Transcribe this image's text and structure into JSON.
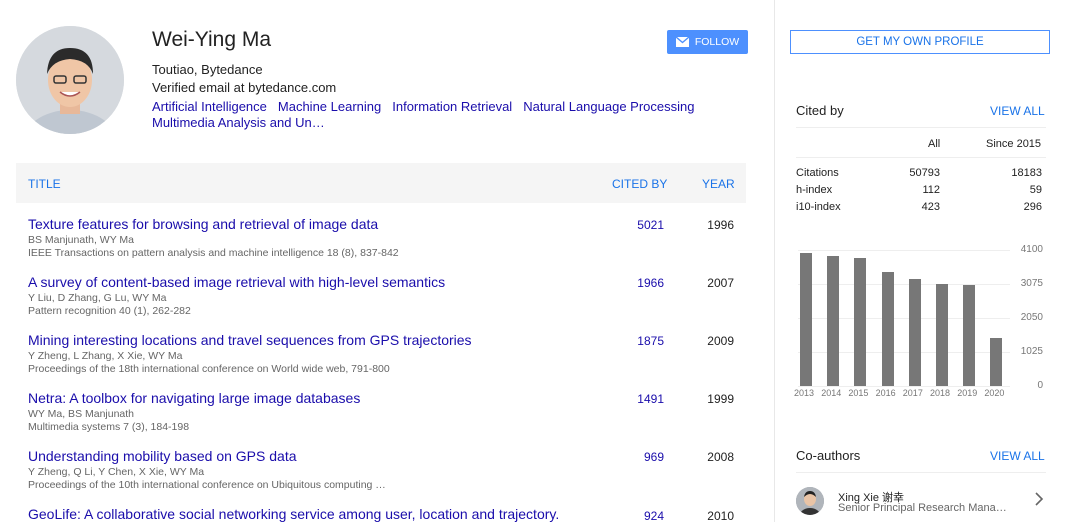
{
  "profile": {
    "name": "Wei-Ying Ma",
    "affiliation": "Toutiao, Bytedance",
    "email": "Verified email at bytedance.com",
    "interests": [
      "Artificial Intelligence",
      "Machine Learning",
      "Information Retrieval",
      "Natural Language Processing",
      "Multimedia Analysis and Un…"
    ],
    "follow_label": "FOLLOW"
  },
  "table": {
    "col_title": "TITLE",
    "col_cited": "CITED BY",
    "col_year": "YEAR",
    "rows": [
      {
        "title": "Texture features for browsing and retrieval of image data",
        "authors": "BS Manjunath, WY Ma",
        "venue": "IEEE Transactions on pattern analysis and machine intelligence 18 (8), 837-842",
        "cited": "5021",
        "year": "1996"
      },
      {
        "title": "A survey of content-based image retrieval with high-level semantics",
        "authors": "Y Liu, D Zhang, G Lu, WY Ma",
        "venue": "Pattern recognition 40 (1), 262-282",
        "cited": "1966",
        "year": "2007"
      },
      {
        "title": "Mining interesting locations and travel sequences from GPS trajectories",
        "authors": "Y Zheng, L Zhang, X Xie, WY Ma",
        "venue": "Proceedings of the 18th international conference on World wide web, 791-800",
        "cited": "1875",
        "year": "2009"
      },
      {
        "title": "Netra: A toolbox for navigating large image databases",
        "authors": "WY Ma, BS Manjunath",
        "venue": "Multimedia systems 7 (3), 184-198",
        "cited": "1491",
        "year": "1999"
      },
      {
        "title": "Understanding mobility based on GPS data",
        "authors": "Y Zheng, Q Li, Y Chen, X Xie, WY Ma",
        "venue": "Proceedings of the 10th international conference on Ubiquitous computing …",
        "cited": "969",
        "year": "2008"
      },
      {
        "title": "GeoLife: A collaborative social networking service among user, location and trajectory.",
        "authors": "",
        "venue": "",
        "cited": "924",
        "year": "2010"
      }
    ]
  },
  "sidebar": {
    "get_profile": "GET MY OWN PROFILE",
    "cited_by": "Cited by",
    "view_all": "VIEW ALL",
    "col_all": "All",
    "col_since": "Since 2015",
    "stats": [
      {
        "label": "Citations",
        "all": "50793",
        "since": "18183"
      },
      {
        "label": "h-index",
        "all": "112",
        "since": "59"
      },
      {
        "label": "i10-index",
        "all": "423",
        "since": "296"
      }
    ],
    "coauthors_title": "Co-authors",
    "coauthors_view_all": "VIEW ALL",
    "coauthor": {
      "name": "Xing Xie 谢幸",
      "title": "Senior Principal Research Mana…"
    }
  },
  "chart_data": {
    "type": "bar",
    "categories": [
      "2013",
      "2014",
      "2015",
      "2016",
      "2017",
      "2018",
      "2019",
      "2020"
    ],
    "values": [
      4000,
      3930,
      3850,
      3430,
      3220,
      3060,
      3040,
      1450
    ],
    "ylim": [
      0,
      4100
    ],
    "yticks": [
      "4100",
      "3075",
      "2050",
      "1025",
      "0"
    ],
    "color": "#777777"
  }
}
